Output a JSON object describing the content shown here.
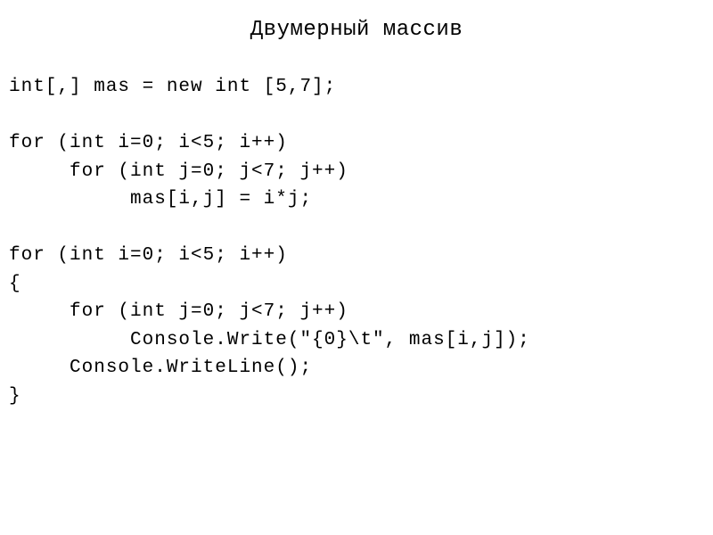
{
  "title": "Двумерный массив",
  "code_lines": [
    "int[,] mas = new int [5,7];",
    "",
    "for (int i=0; i<5; i++)",
    "     for (int j=0; j<7; j++)",
    "          mas[i,j] = i*j;",
    "",
    "for (int i=0; i<5; i++)",
    "{",
    "     for (int j=0; j<7; j++)",
    "          Console.Write(\"{0}\\t\", mas[i,j]);",
    "     Console.WriteLine();",
    "}"
  ]
}
